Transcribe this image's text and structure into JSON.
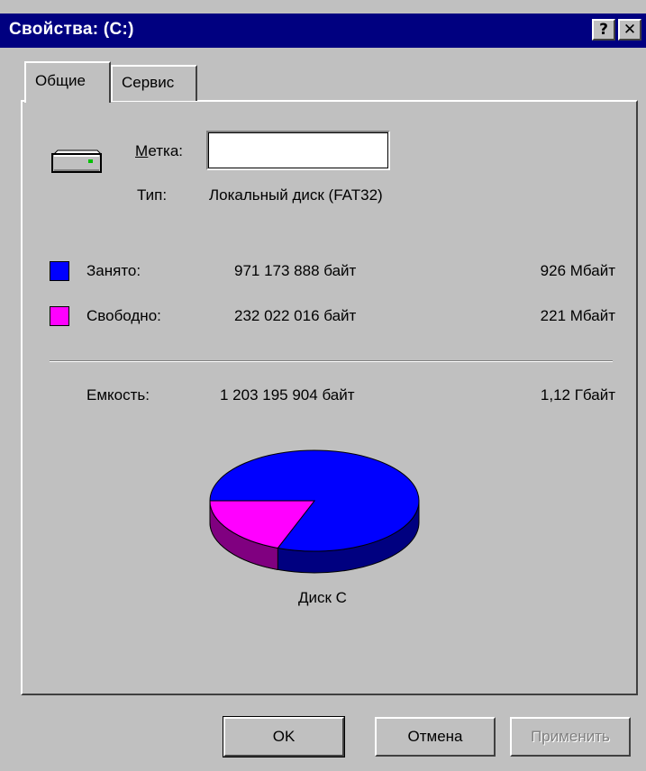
{
  "window": {
    "title": "Свойства:  (C:)",
    "help_label": "?",
    "close_label": "✕"
  },
  "tabs": [
    {
      "label": "Общие",
      "active": true
    },
    {
      "label": "Сервис",
      "active": false
    }
  ],
  "general": {
    "label_field": {
      "prefix": "М",
      "rest": "етка:",
      "value": ""
    },
    "type": {
      "label": "Тип:",
      "value": "Локальный диск (FAT32)"
    },
    "used": {
      "label": "Занято:",
      "bytes": "971 173 888 байт",
      "size": "926 Мбайт",
      "color": "#0000ff"
    },
    "free": {
      "label": "Свободно:",
      "bytes": "232 022 016 байт",
      "size": "221 Мбайт",
      "color": "#ff00ff"
    },
    "capacity": {
      "label": "Емкость:",
      "bytes": "1 203 195 904 байт",
      "size": "1,12 Гбайт"
    },
    "disk_caption": "Диск C",
    "used_fraction": 0.807
  },
  "buttons": {
    "ok": "OK",
    "cancel": "Отмена",
    "apply": "Применить"
  }
}
